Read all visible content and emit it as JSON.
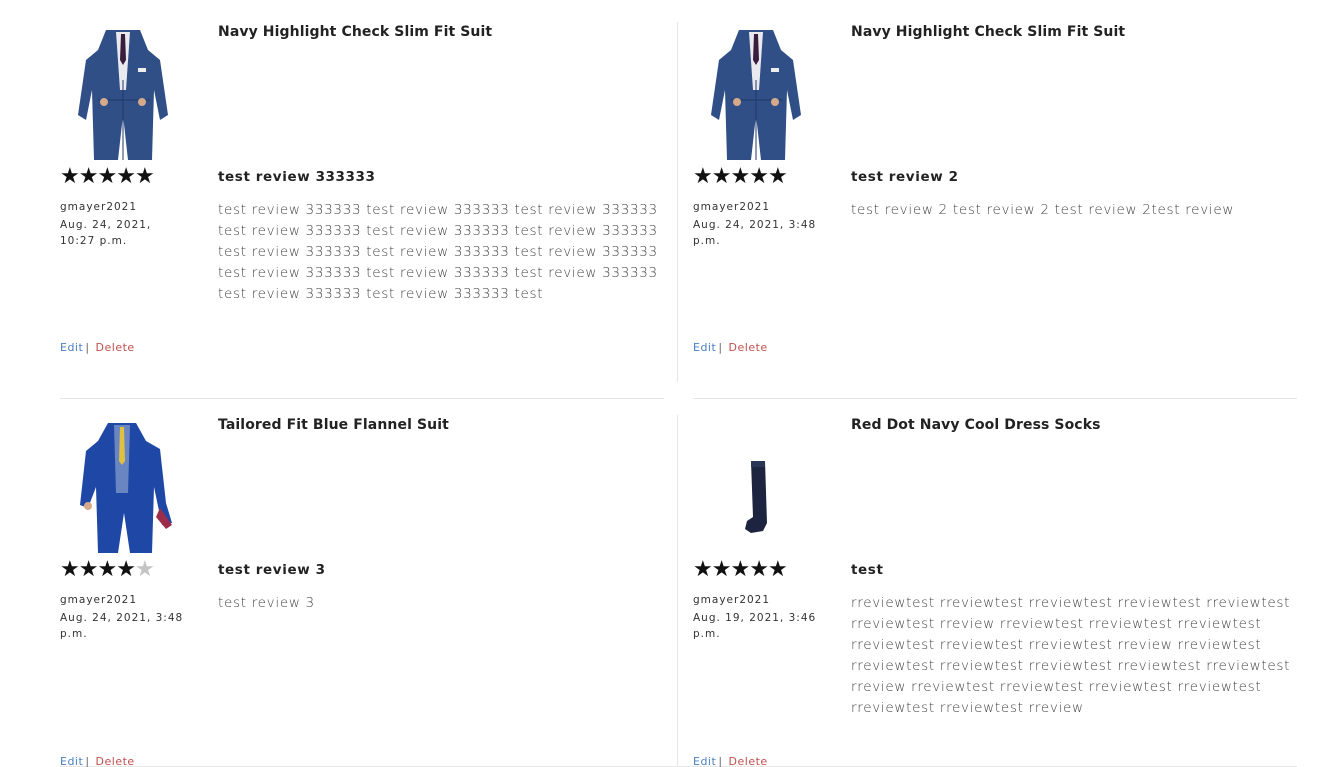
{
  "reviews": [
    {
      "product_name": "Navy Highlight Check Slim Fit Suit",
      "product_image": "navy-suit-image",
      "rating": 5,
      "review_title": "test review 333333",
      "author": "gmayer2021",
      "date": "Aug. 24, 2021, 10:27 p.m.",
      "body": "test review 333333 test review 333333 test review 333333 test review 333333 test review 333333 test review 333333 test review 333333 test review 333333 test review 333333 test review 333333 test review 333333 test review 333333 test review 333333 test review 333333 test",
      "edit_label": "Edit",
      "separator": "|",
      "delete_label": "Delete"
    },
    {
      "product_name": "Navy Highlight Check Slim Fit Suit",
      "product_image": "navy-suit-image",
      "rating": 5,
      "review_title": "test review 2",
      "author": "gmayer2021",
      "date": "Aug. 24, 2021, 3:48 p.m.",
      "body": "test review 2 test review 2 test review 2test review",
      "edit_label": "Edit",
      "separator": "|",
      "delete_label": "Delete"
    },
    {
      "product_name": "Tailored Fit Blue Flannel Suit",
      "product_image": "blue-flannel-suit-image",
      "rating": 4,
      "review_title": "test review 3",
      "author": "gmayer2021",
      "date": "Aug. 24, 2021, 3:48 p.m.",
      "body": "test review 3",
      "edit_label": "Edit",
      "separator": "|",
      "delete_label": "Delete"
    },
    {
      "product_name": "Red Dot Navy Cool Dress Socks",
      "product_image": "navy-socks-image",
      "rating": 5,
      "review_title": "test",
      "author": "gmayer2021",
      "date": "Aug. 19, 2021, 3:46 p.m.",
      "body": "rreviewtest rreviewtest rreviewtest rreviewtest rreviewtest rreviewtest rreview rreviewtest rreviewtest rreviewtest rreviewtest rreviewtest rreviewtest rreview rreviewtest rreviewtest rreviewtest rreviewtest rreviewtest rreviewtest rreview rreviewtest rreviewtest rreviewtest rreviewtest rreviewtest rreviewtest rreview",
      "edit_label": "Edit",
      "separator": "|",
      "delete_label": "Delete"
    }
  ],
  "colors": {
    "edit_link": "#4a7fc4",
    "delete_link": "#c0504d",
    "star_on": "#111111",
    "star_off": "#c4c4c4",
    "divider": "#e6e6e6"
  }
}
